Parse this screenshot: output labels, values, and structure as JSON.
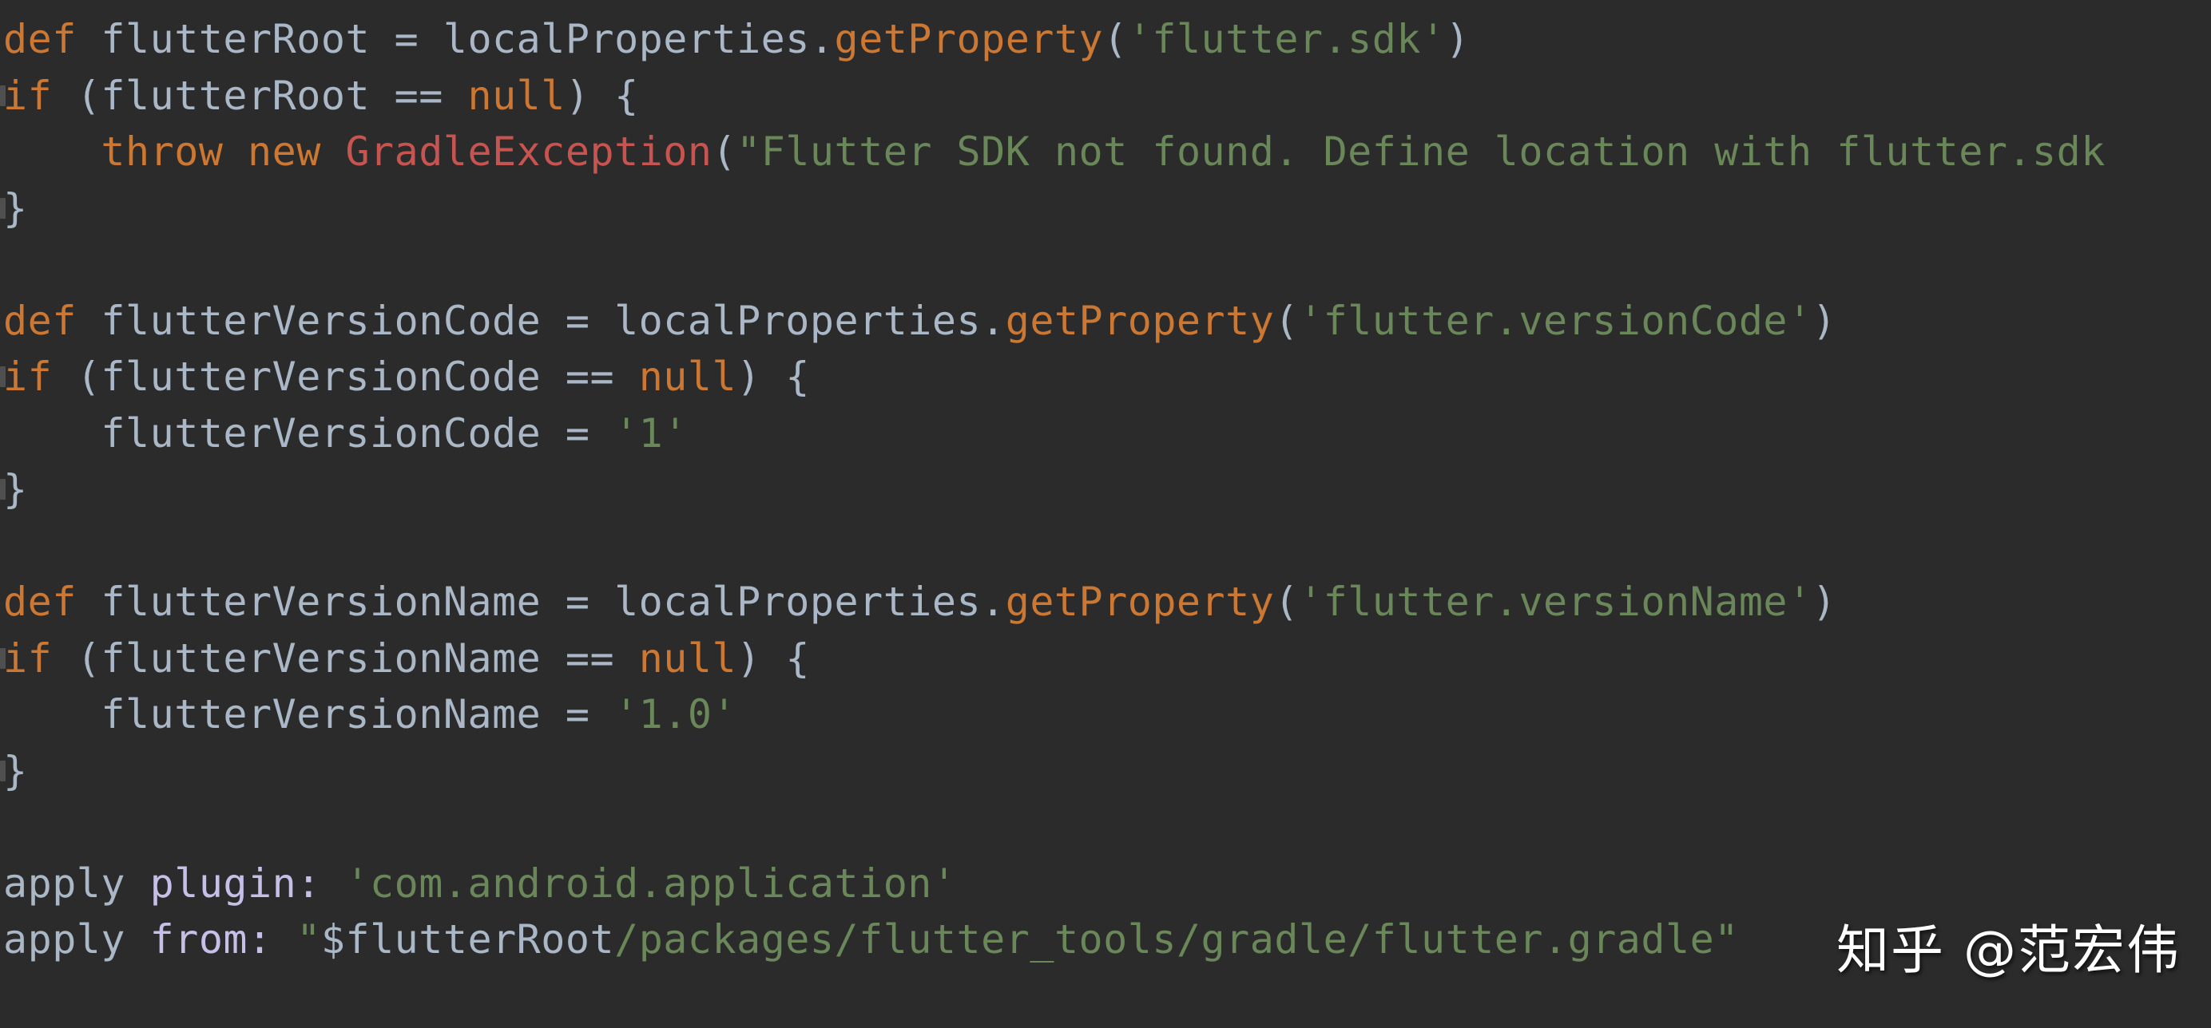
{
  "editor": {
    "theme": "Darcula",
    "background_color": "#2b2b2b",
    "language": "Gradle (Groovy)",
    "colors": {
      "keyword": "#cc7832",
      "string": "#6a8759",
      "class_name": "#c75450",
      "identifier": "#a9b7c6",
      "label": "#c6c0e8"
    }
  },
  "code": {
    "lines": [
      {
        "index": 1,
        "text": "def flutterRoot = localProperties.getProperty('flutter.sdk')",
        "tokens": [
          {
            "t": "def",
            "c": "kw"
          },
          {
            "t": " flutterRoot = localProperties.",
            "c": "txt"
          },
          {
            "t": "getProperty",
            "c": "meth"
          },
          {
            "t": "(",
            "c": "txt"
          },
          {
            "t": "'flutter.sdk'",
            "c": "str"
          },
          {
            "t": ")",
            "c": "txt"
          }
        ]
      },
      {
        "index": 2,
        "text": "if (flutterRoot == null) {",
        "tokens": [
          {
            "t": "if",
            "c": "kw"
          },
          {
            "t": " (flutterRoot == ",
            "c": "txt"
          },
          {
            "t": "null",
            "c": "kw"
          },
          {
            "t": ") {",
            "c": "txt"
          }
        ]
      },
      {
        "index": 3,
        "text": "    throw new GradleException(\"Flutter SDK not found. Define location with flutter.sdk",
        "tokens": [
          {
            "t": "    ",
            "c": "txt"
          },
          {
            "t": "throw new ",
            "c": "kw"
          },
          {
            "t": "GradleException",
            "c": "cls"
          },
          {
            "t": "(",
            "c": "txt"
          },
          {
            "t": "\"Flutter SDK not found. Define location with flutter.sdk",
            "c": "str"
          }
        ]
      },
      {
        "index": 4,
        "text": "}",
        "tokens": [
          {
            "t": "}",
            "c": "txt"
          }
        ]
      },
      {
        "index": 5,
        "text": "",
        "tokens": []
      },
      {
        "index": 6,
        "text": "def flutterVersionCode = localProperties.getProperty('flutter.versionCode')",
        "tokens": [
          {
            "t": "def",
            "c": "kw"
          },
          {
            "t": " flutterVersionCode = localProperties.",
            "c": "txt"
          },
          {
            "t": "getProperty",
            "c": "meth"
          },
          {
            "t": "(",
            "c": "txt"
          },
          {
            "t": "'flutter.versionCode'",
            "c": "str"
          },
          {
            "t": ")",
            "c": "txt"
          }
        ]
      },
      {
        "index": 7,
        "text": "if (flutterVersionCode == null) {",
        "tokens": [
          {
            "t": "if",
            "c": "kw"
          },
          {
            "t": " (flutterVersionCode == ",
            "c": "txt"
          },
          {
            "t": "null",
            "c": "kw"
          },
          {
            "t": ") {",
            "c": "txt"
          }
        ]
      },
      {
        "index": 8,
        "text": "    flutterVersionCode = '1'",
        "tokens": [
          {
            "t": "    flutterVersionCode = ",
            "c": "txt"
          },
          {
            "t": "'1'",
            "c": "str"
          }
        ]
      },
      {
        "index": 9,
        "text": "}",
        "tokens": [
          {
            "t": "}",
            "c": "txt"
          }
        ]
      },
      {
        "index": 10,
        "text": "",
        "tokens": []
      },
      {
        "index": 11,
        "text": "def flutterVersionName = localProperties.getProperty('flutter.versionName')",
        "tokens": [
          {
            "t": "def",
            "c": "kw"
          },
          {
            "t": " flutterVersionName = localProperties.",
            "c": "txt"
          },
          {
            "t": "getProperty",
            "c": "meth"
          },
          {
            "t": "(",
            "c": "txt"
          },
          {
            "t": "'flutter.versionName'",
            "c": "str"
          },
          {
            "t": ")",
            "c": "txt"
          }
        ]
      },
      {
        "index": 12,
        "text": "if (flutterVersionName == null) {",
        "tokens": [
          {
            "t": "if",
            "c": "kw"
          },
          {
            "t": " (flutterVersionName == ",
            "c": "txt"
          },
          {
            "t": "null",
            "c": "kw"
          },
          {
            "t": ") {",
            "c": "txt"
          }
        ]
      },
      {
        "index": 13,
        "text": "    flutterVersionName = '1.0'",
        "tokens": [
          {
            "t": "    flutterVersionName = ",
            "c": "txt"
          },
          {
            "t": "'1.0'",
            "c": "str"
          }
        ]
      },
      {
        "index": 14,
        "text": "}",
        "tokens": [
          {
            "t": "}",
            "c": "txt"
          }
        ]
      },
      {
        "index": 15,
        "text": "",
        "tokens": []
      },
      {
        "index": 16,
        "text": "apply plugin: 'com.android.application'",
        "tokens": [
          {
            "t": "apply ",
            "c": "txt"
          },
          {
            "t": "plugin:",
            "c": "lav"
          },
          {
            "t": " ",
            "c": "txt"
          },
          {
            "t": "'com.android.application'",
            "c": "str"
          }
        ]
      },
      {
        "index": 17,
        "text": "apply from: \"$flutterRoot/packages/flutter_tools/gradle/flutter.gradle\"",
        "tokens": [
          {
            "t": "apply ",
            "c": "txt"
          },
          {
            "t": "from:",
            "c": "lav"
          },
          {
            "t": " ",
            "c": "txt"
          },
          {
            "t": "\"",
            "c": "str"
          },
          {
            "t": "$flutterRoot",
            "c": "interp"
          },
          {
            "t": "/packages/flutter_tools/gradle/flutter.gradle\"",
            "c": "str"
          }
        ]
      }
    ]
  },
  "gutter": {
    "fold_marker_lines": [
      2,
      4,
      7,
      9,
      12,
      14
    ]
  },
  "watermark": {
    "text": "知乎 @范宏伟",
    "color": "#ffffff"
  }
}
